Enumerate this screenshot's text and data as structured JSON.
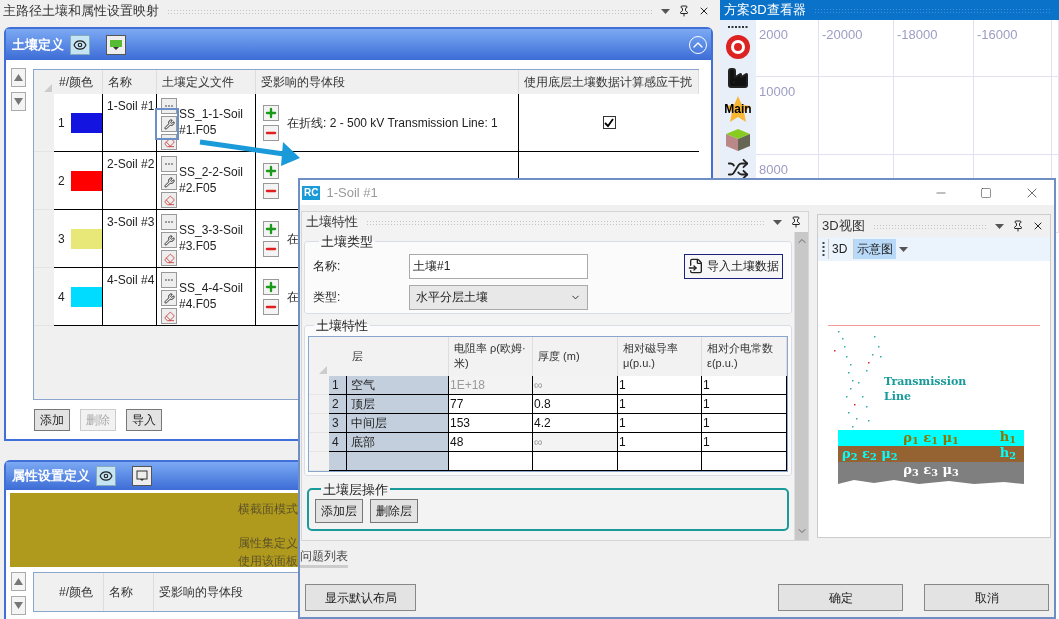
{
  "left_pane": {
    "title": "主路径土壤和属性设置映射"
  },
  "soil_panel": {
    "title": "土壤定义",
    "columns": [
      "#/颜色",
      "名称",
      "土壤定义文件",
      "受影响的导体段",
      "使用底层土壤数据计算感应干扰"
    ],
    "rows": [
      {
        "num": "1",
        "color": "#1414e0",
        "name": "1-Soil #1",
        "file": "SS_1-1-Soil #1.F05",
        "conductor": "在折线: 2 - 500 kV Transmission Line: 1",
        "checked": true
      },
      {
        "num": "2",
        "color": "#ff0000",
        "name": "2-Soil #2",
        "file": "SS_2-2-Soil #2.F05"
      },
      {
        "num": "3",
        "color": "#e8e878",
        "name": "3-Soil #3",
        "file": "SS_3-3-Soil #3.F05",
        "conductor": "在"
      },
      {
        "num": "4",
        "color": "#00dcff",
        "name": "4-Soil #4",
        "file": "SS_4-4-Soil #4.F05",
        "conductor": "在"
      }
    ],
    "buttons": [
      {
        "label": "添加",
        "disabled": false
      },
      {
        "label": "删除",
        "disabled": true
      },
      {
        "label": "导入",
        "disabled": false
      }
    ]
  },
  "attr_panel": {
    "title": "属性设置定义",
    "notes": [
      "横截面模式",
      "属性集定义",
      "使用该面板"
    ],
    "columns": [
      "#/颜色",
      "名称",
      "受影响的导体段"
    ]
  },
  "viewer": {
    "title": "方案3D查看器",
    "main_badge": "Main",
    "x_labels": [
      "2000",
      "-20000",
      "-18000",
      "-16000"
    ],
    "y_labels": [
      "10000",
      "8000"
    ]
  },
  "dialog": {
    "badge": "RC",
    "title": "1-Soil #1",
    "soil_props": {
      "title": "土壤特性",
      "type_group": "土壤类型",
      "name_label": "名称:",
      "name_value": "土壤#1",
      "type_label": "类型:",
      "type_value": "水平分层土壤",
      "import_button": "导入土壤数据",
      "props_group": "土壤特性",
      "columns": [
        "层",
        "电阻率 ρ(欧姆·米)",
        "厚度 (m)",
        "相对磁导率 μ(p.u.)",
        "相对介电常数ε(p.u.)"
      ],
      "rows": [
        {
          "num": "1",
          "name": "空气",
          "values": [
            {
              "text": "1E+18",
              "disabled": true
            },
            {
              "text": "∞",
              "disabled": true
            },
            {
              "text": "1",
              "disabled": false
            },
            {
              "text": "1",
              "disabled": false
            }
          ]
        },
        {
          "num": "2",
          "name": "顶层",
          "values": [
            {
              "text": "77",
              "disabled": false
            },
            {
              "text": "0.8",
              "disabled": false
            },
            {
              "text": "1",
              "disabled": false
            },
            {
              "text": "1",
              "disabled": false
            }
          ]
        },
        {
          "num": "3",
          "name": "中间层",
          "values": [
            {
              "text": "153",
              "disabled": false
            },
            {
              "text": "4.2",
              "disabled": false
            },
            {
              "text": "1",
              "disabled": false
            },
            {
              "text": "1",
              "disabled": false
            }
          ]
        },
        {
          "num": "4",
          "name": "底部",
          "values": [
            {
              "text": "48",
              "disabled": false
            },
            {
              "text": "∞",
              "disabled": true
            },
            {
              "text": "1",
              "disabled": false
            },
            {
              "text": "1",
              "disabled": false
            }
          ]
        }
      ],
      "ops_group": "土壤层操作",
      "ops_buttons": [
        "添加层",
        "删除层"
      ]
    },
    "problems_tab": "问题列表",
    "view3d": {
      "title": "3D视图",
      "tabs": [
        {
          "label": "3D",
          "selected": false
        },
        {
          "label": "示意图",
          "selected": true
        }
      ],
      "diagram": {
        "line_label": "Transmission Line",
        "layers": [
          {
            "label": "ρ$_{1}$ ε$_{1}$ μ$_{1}$",
            "thickness": "h$_{1}$",
            "color": "#00ffff"
          },
          {
            "label": "ρ$_{2}$ ε$_{2}$ μ$_{2}$",
            "thickness": "h$_{2}$",
            "color": "#956331"
          },
          {
            "label": "ρ$_{3}$ ε$_{3}$ μ$_{3}$",
            "color": "#7f7f7f"
          }
        ]
      }
    },
    "footer_buttons": [
      "显示默认布局",
      "确定",
      "取消"
    ]
  }
}
